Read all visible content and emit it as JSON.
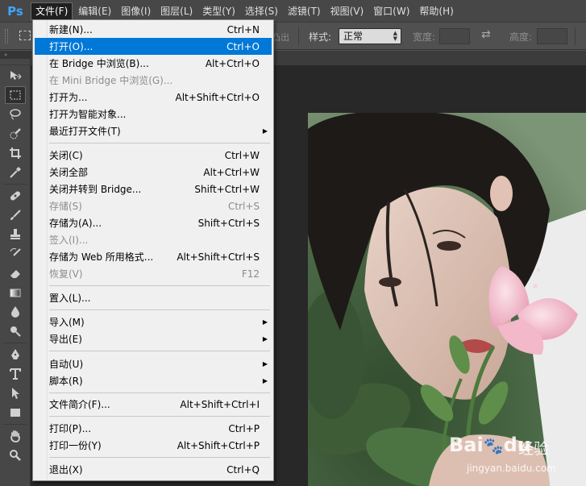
{
  "app": {
    "logo": "Ps",
    "logo_color": "#3fa6ff"
  },
  "menubar": {
    "items": [
      "文件(F)",
      "编辑(E)",
      "图像(I)",
      "图层(L)",
      "类型(Y)",
      "选择(S)",
      "滤镜(T)",
      "视图(V)",
      "窗口(W)",
      "帮助(H)"
    ],
    "active_index": 0
  },
  "options": {
    "faded_text": "凸出",
    "style_label": "样式:",
    "style_value": "正常",
    "width_label": "宽度:",
    "height_label": "高度:",
    "swap_icon": "swap-arrows-icon"
  },
  "file_menu": {
    "highlight_color": "#0078d7",
    "items": [
      {
        "label": "新建(N)...",
        "shortcut": "Ctrl+N"
      },
      {
        "label": "打开(O)...",
        "shortcut": "Ctrl+O",
        "highlighted": true
      },
      {
        "label": "在 Bridge 中浏览(B)...",
        "shortcut": "Alt+Ctrl+O"
      },
      {
        "label": "在 Mini Bridge 中浏览(G)...",
        "shortcut": "",
        "disabled": true
      },
      {
        "label": "打开为...",
        "shortcut": "Alt+Shift+Ctrl+O"
      },
      {
        "label": "打开为智能对象...",
        "shortcut": ""
      },
      {
        "label": "最近打开文件(T)",
        "shortcut": "",
        "submenu": true
      },
      {
        "label": "关闭(C)",
        "shortcut": "Ctrl+W"
      },
      {
        "label": "关闭全部",
        "shortcut": "Alt+Ctrl+W"
      },
      {
        "label": "关闭并转到 Bridge...",
        "shortcut": "Shift+Ctrl+W"
      },
      {
        "label": "存储(S)",
        "shortcut": "Ctrl+S",
        "disabled": true
      },
      {
        "label": "存储为(A)...",
        "shortcut": "Shift+Ctrl+S"
      },
      {
        "label": "签入(I)...",
        "shortcut": "",
        "disabled": true
      },
      {
        "label": "存储为 Web 所用格式...",
        "shortcut": "Alt+Shift+Ctrl+S"
      },
      {
        "label": "恢复(V)",
        "shortcut": "F12",
        "disabled": true
      },
      {
        "label": "置入(L)...",
        "shortcut": ""
      },
      {
        "label": "导入(M)",
        "shortcut": "",
        "submenu": true
      },
      {
        "label": "导出(E)",
        "shortcut": "",
        "submenu": true
      },
      {
        "label": "自动(U)",
        "shortcut": "",
        "submenu": true
      },
      {
        "label": "脚本(R)",
        "shortcut": "",
        "submenu": true
      },
      {
        "label": "文件简介(F)...",
        "shortcut": "Alt+Shift+Ctrl+I"
      },
      {
        "label": "打印(P)...",
        "shortcut": "Ctrl+P"
      },
      {
        "label": "打印一份(Y)",
        "shortcut": "Alt+Shift+Ctrl+P"
      },
      {
        "label": "退出(X)",
        "shortcut": "Ctrl+Q"
      }
    ]
  },
  "toolbox": {
    "header": "»",
    "tools": [
      "move-tool-icon",
      "rectangular-marquee-tool-icon",
      "lasso-tool-icon",
      "quick-selection-tool-icon",
      "crop-tool-icon",
      "eyedropper-tool-icon",
      "spot-healing-brush-icon",
      "brush-tool-icon",
      "clone-stamp-tool-icon",
      "history-brush-icon",
      "eraser-tool-icon",
      "gradient-tool-icon",
      "blur-tool-icon",
      "dodge-tool-icon",
      "pen-tool-icon",
      "type-tool-icon",
      "path-selection-tool-icon",
      "rectangle-tool-icon",
      "hand-tool-icon",
      "zoom-tool-icon"
    ],
    "selected": "rectangular-marquee-tool-icon"
  },
  "watermark": {
    "brand": "Bai",
    "brand_end": "du",
    "product": "经验",
    "url": "jingyan.baidu.com"
  }
}
